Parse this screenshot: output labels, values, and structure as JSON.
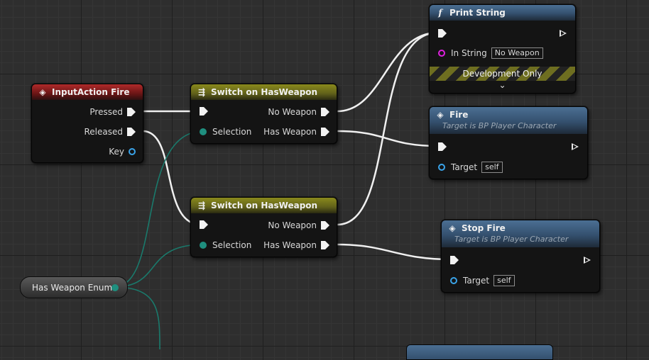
{
  "nodes": {
    "input_action": {
      "title": "InputAction Fire",
      "pins": {
        "pressed": "Pressed",
        "released": "Released",
        "key": "Key"
      }
    },
    "switch_top": {
      "title": "Switch on HasWeapon",
      "pins": {
        "selection": "Selection",
        "no_weapon": "No Weapon",
        "has_weapon": "Has Weapon"
      }
    },
    "switch_bottom": {
      "title": "Switch on HasWeapon",
      "pins": {
        "selection": "Selection",
        "no_weapon": "No Weapon",
        "has_weapon": "Has Weapon"
      }
    },
    "print_string": {
      "title": "Print String",
      "in_string_label": "In String",
      "in_string_value": "No Weapon",
      "dev_only": "Development Only"
    },
    "fire": {
      "title": "Fire",
      "subtitle": "Target is BP Player Character",
      "target_label": "Target",
      "target_value": "self"
    },
    "stop_fire": {
      "title": "Stop Fire",
      "subtitle": "Target is BP Player Character",
      "target_label": "Target",
      "target_value": "self"
    },
    "has_weapon_enum": {
      "title": "Has Weapon Enum"
    }
  },
  "colors": {
    "exec_wire": "#f0f0f0",
    "enum_wire": "#1a7a6c",
    "event_header": "#b02a2a",
    "switch_header": "#8a8a1c",
    "function_header": "#4b6f93"
  },
  "icons": {
    "event": "event-diamond-icon",
    "switch": "switch-branch-icon",
    "function": "function-f-icon"
  }
}
